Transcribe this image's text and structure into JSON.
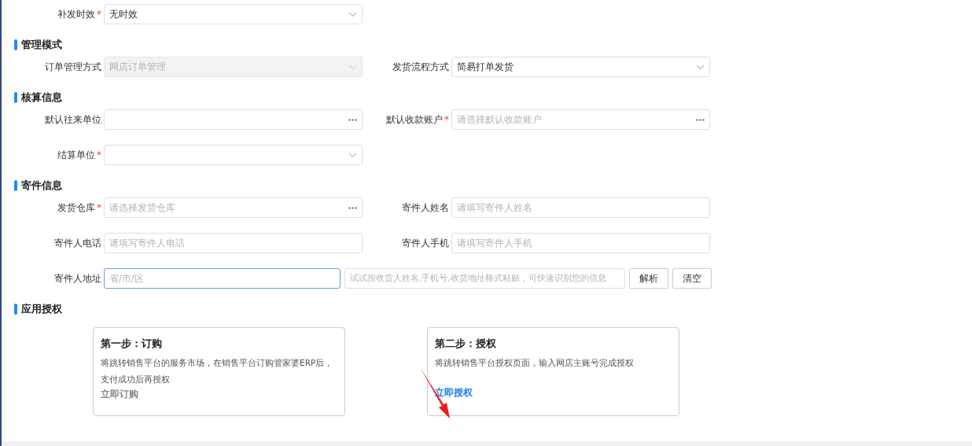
{
  "top_rows": [
    [
      {
        "label": "补发时效",
        "required_mark": "*",
        "kind": "select",
        "value": "无时效",
        "disabled": false
      }
    ]
  ],
  "sections": [
    {
      "title": "管理模式",
      "rows": [
        [
          {
            "label": "订单管理方式",
            "kind": "select",
            "value": "网店订单管理",
            "disabled": true
          },
          {
            "label": "发货流程方式",
            "kind": "select",
            "value": "简易打单发货",
            "disabled": false
          }
        ]
      ]
    },
    {
      "title": "核算信息",
      "rows": [
        [
          {
            "label": "默认往来单位",
            "kind": "picker",
            "disabled": false
          },
          {
            "label": "默认收款账户",
            "required_mark": "*",
            "kind": "picker",
            "placeholder": "请选择默认收款账户",
            "disabled": false
          }
        ],
        [
          {
            "label": "结算单位",
            "required_mark": "*",
            "kind": "select",
            "disabled": false
          }
        ]
      ]
    },
    {
      "title": "寄件信息",
      "rows": [
        [
          {
            "label": "发货仓库",
            "required_mark": "*",
            "kind": "picker",
            "placeholder": "请选择发货仓库",
            "disabled": false
          },
          {
            "label": "寄件人姓名",
            "kind": "text",
            "placeholder": "请填写寄件人姓名",
            "disabled": false
          }
        ],
        [
          {
            "label": "寄件人电话",
            "kind": "text",
            "placeholder": "请填写寄件人电话",
            "disabled": false
          },
          {
            "label": "寄件人手机",
            "kind": "text",
            "placeholder": "请填写寄件人手机",
            "disabled": false
          }
        ],
        [
          {
            "label": "寄件人地址",
            "kind": "address",
            "placeholder": "省/市/区",
            "focused": true,
            "paste_placeholder": "试试按收货人姓名,手机号,收货地址格式粘贴，可快速识别您的信息",
            "buttons": [
              "解析",
              "清空"
            ]
          }
        ]
      ]
    }
  ],
  "authorization": {
    "title": "应用授权",
    "steps": [
      {
        "title": "第一步：订购",
        "description_lines": [
          "将跳转销售平台的服务市场，在销售平台订购管家婆ERP后，",
          "支付成功后再授权"
        ],
        "link": "立即订购",
        "enabled": false
      },
      {
        "title": "第二步：授权",
        "description_lines": [
          "将跳转销售平台授权页面，输入网店主账号完成授权"
        ],
        "link": "立即授权",
        "enabled": true
      }
    ]
  }
}
